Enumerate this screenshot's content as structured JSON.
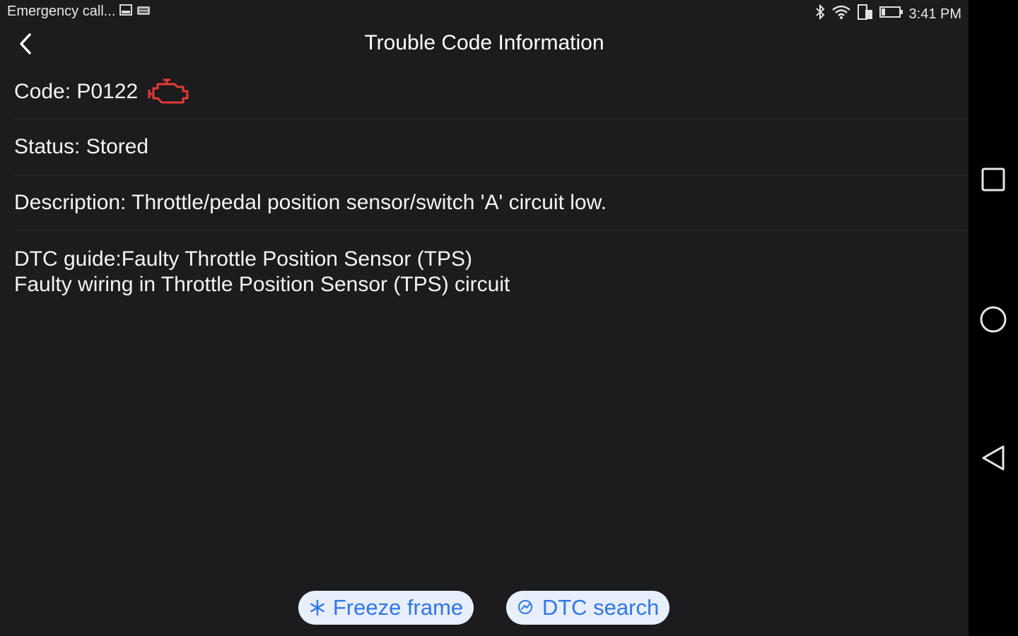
{
  "status_bar": {
    "left_text": "Emergency call...",
    "left_icons": [
      "image-icon",
      "message-icon"
    ],
    "right_icons": [
      "bluetooth-icon",
      "wifi-icon",
      "sim-icon",
      "battery-icon"
    ],
    "time": "3:41 PM"
  },
  "appbar": {
    "title": "Trouble Code Information",
    "back_icon": "back-arrow-icon"
  },
  "dtc": {
    "code_label": "Code: P0122",
    "engine_icon": "check-engine-icon",
    "engine_icon_color": "#e53935",
    "status_label": "Status: Stored",
    "description_label": "Description: Throttle/pedal position sensor/switch 'A' circuit low.",
    "guide_line1": "DTC guide:Faulty Throttle Position Sensor (TPS)",
    "guide_line2": "Faulty wiring in Throttle Position Sensor (TPS) circuit"
  },
  "actions": {
    "freeze_label": "Freeze frame",
    "freeze_icon": "snowflake-icon",
    "dtc_search_label": "DTC search",
    "dtc_search_icon": "search-icon",
    "accent_color": "#2f77e6"
  },
  "nav": {
    "recents_icon": "square-icon",
    "home_icon": "circle-icon",
    "back_icon": "triangle-back-icon"
  }
}
